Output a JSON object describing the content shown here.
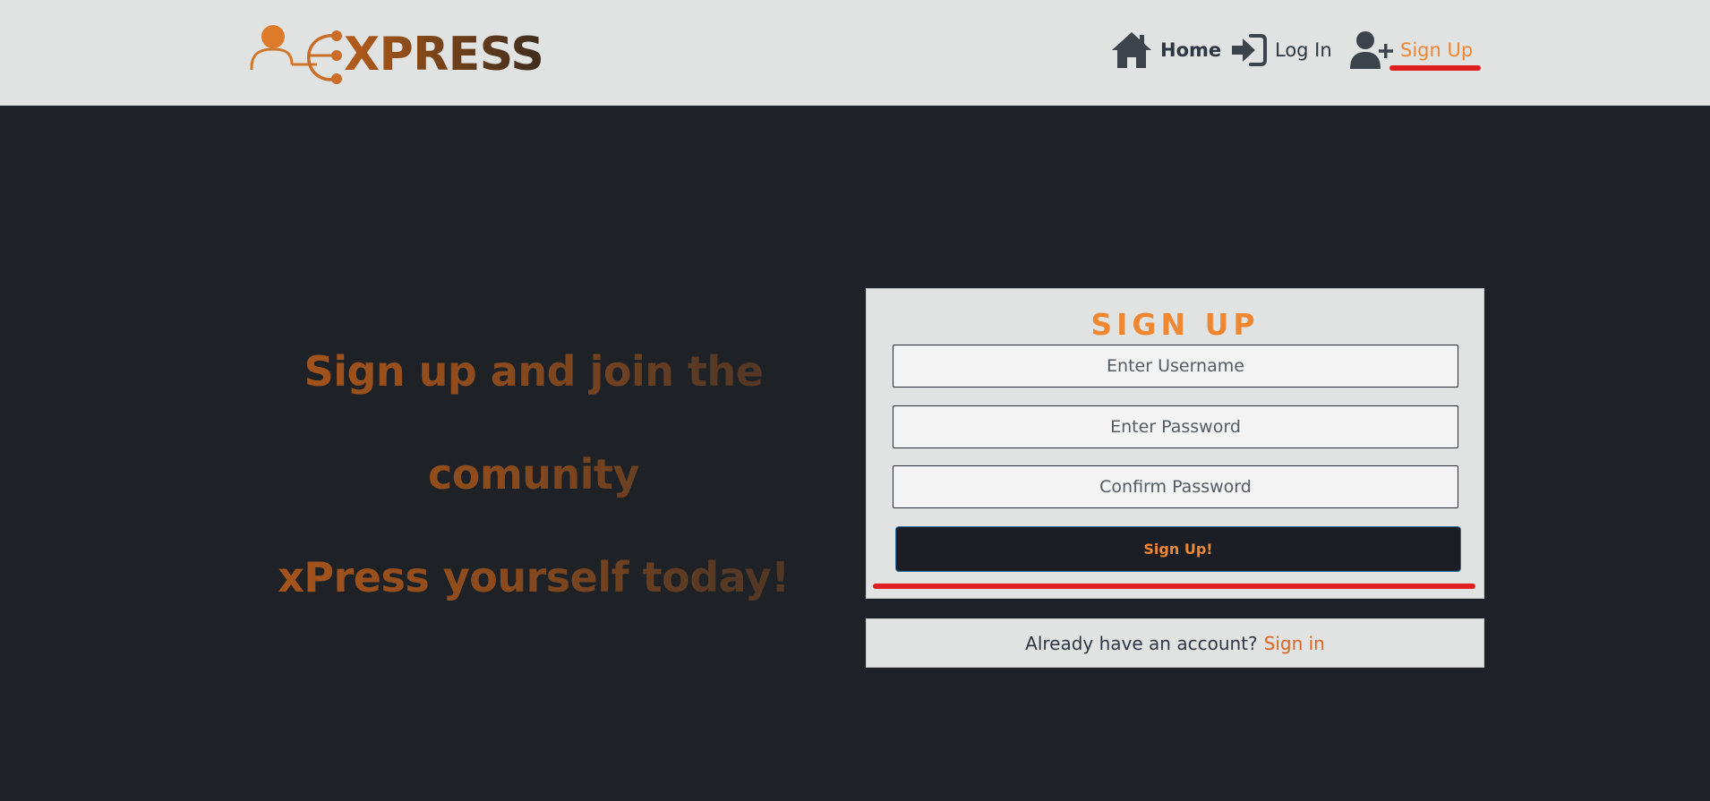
{
  "header": {
    "logo_text": "XPRESS",
    "nav": [
      {
        "label": "Home",
        "icon": "home-icon"
      },
      {
        "label": "Log In",
        "icon": "login-icon"
      },
      {
        "label": "Sign Up",
        "icon": "add-user-icon",
        "active": true
      }
    ]
  },
  "slogan": {
    "line1": "Sign up and join the",
    "line2": "comunity",
    "line3": "xPress yourself today!"
  },
  "signup_form": {
    "title": "SIGN UP",
    "username_placeholder": "Enter Username",
    "password_placeholder": "Enter Password",
    "confirm_placeholder": "Confirm Password",
    "submit_label": "Sign Up!"
  },
  "signin_prompt": {
    "text": "Already have an account?",
    "link_label": "Sign in"
  },
  "colors": {
    "accent_orange": "#f08630",
    "header_bg": "#e1e3e2",
    "page_bg": "#1e2227",
    "underline_red": "#e0201e",
    "button_bg": "#1b1f25"
  }
}
